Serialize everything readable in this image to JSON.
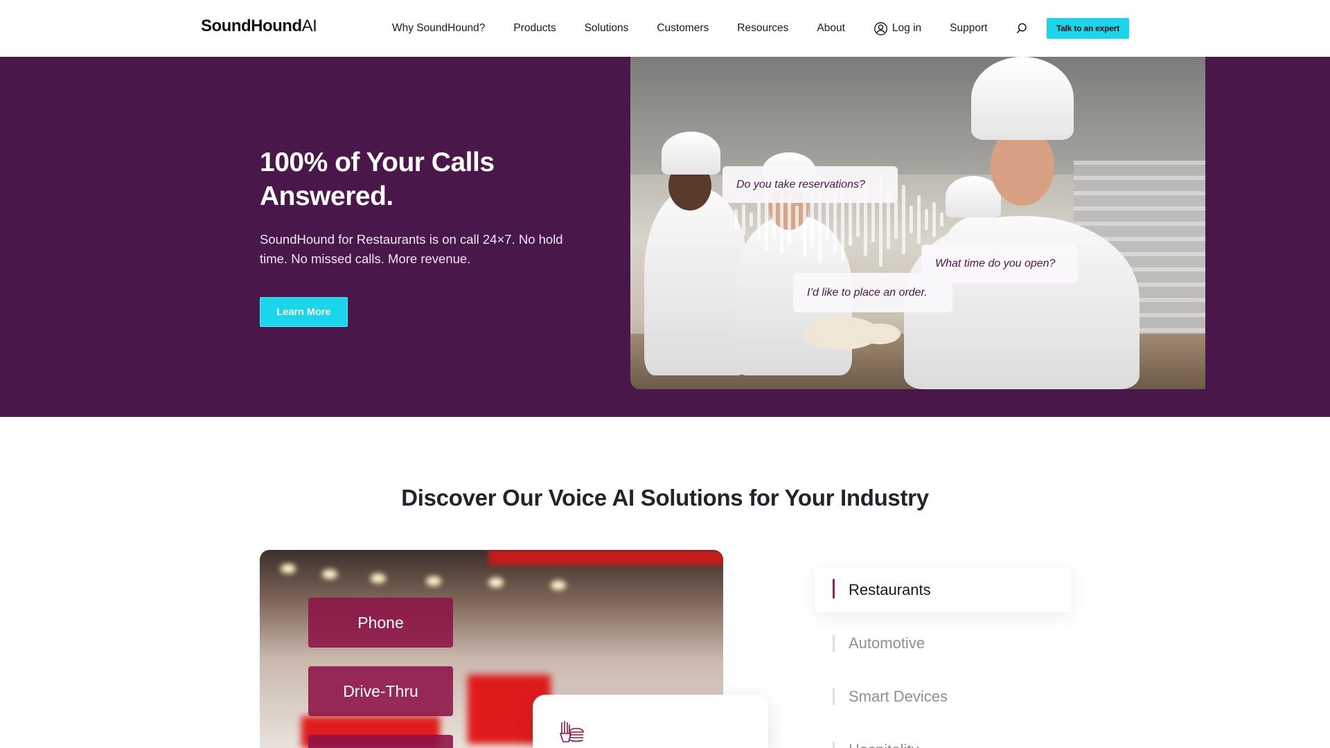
{
  "brand": {
    "name": "SoundHound",
    "suffix": "AI"
  },
  "nav": {
    "items": [
      "Why SoundHound?",
      "Products",
      "Solutions",
      "Customers",
      "Resources",
      "About"
    ],
    "login": "Log in",
    "support": "Support",
    "cta": "Talk to an expert"
  },
  "hero": {
    "title": "100% of Your Calls Answered.",
    "subtitle": "SoundHound for Restaurants is on call 24×7. No hold time. No missed calls. More revenue.",
    "button": "Learn More",
    "bubbles": {
      "reservations": "Do you take reservations?",
      "open_time": "What time do you open?",
      "order": "I’d like to place an order."
    }
  },
  "solutions": {
    "title": "Discover Our Voice AI Solutions for Your Industry",
    "channels": [
      "Phone",
      "Drive-Thru"
    ],
    "tabs": [
      "Restaurants",
      "Automotive",
      "Smart Devices",
      "Hospitality"
    ],
    "active_tab": "Restaurants"
  },
  "colors": {
    "hero_bg": "#4a174a",
    "accent": "#1bd6ea",
    "chip": "#8c1246",
    "tab_marker": "#a31a57"
  },
  "icons": [
    "user-icon",
    "search-icon",
    "burger-fries-icon"
  ]
}
